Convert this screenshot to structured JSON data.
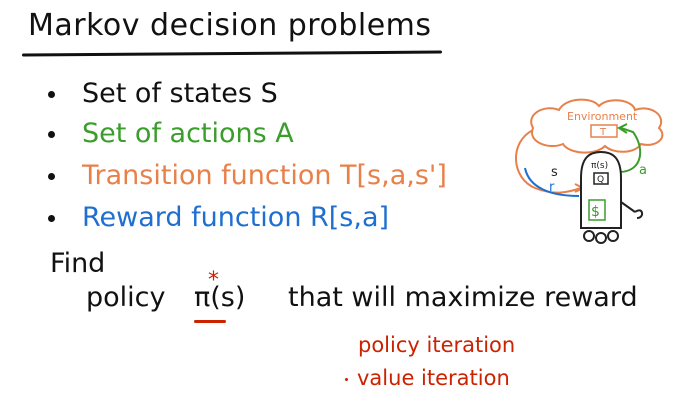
{
  "slide": {
    "title": "Markov decision problems",
    "bullets": [
      {
        "text": "Set of states S",
        "color": "#111111"
      },
      {
        "text": "Set of actions A",
        "color": "#3a9e2a"
      },
      {
        "text": "Transition function T[s,a,s']",
        "color": "#e8804a"
      },
      {
        "text": "Reward function  R[s,a]",
        "color": "#1e6fd0"
      }
    ],
    "find_label": "Find",
    "policy_word": "policy",
    "policy_symbol": "π(s)",
    "policy_star": "*",
    "policy_rest": "that will maximize reward",
    "methods": [
      "policy iteration",
      "value iteration"
    ]
  },
  "diagram": {
    "environment_label": "Environment",
    "t_label": "T",
    "s_label": "s",
    "r_label": "r",
    "a_label": "a",
    "robot_pi_label": "π(s)",
    "robot_q_label": "Q",
    "robot_dollar_label": "$",
    "colors": {
      "environment": "#e8804a",
      "action": "#3a9e2a",
      "reward": "#1e6fd0",
      "robot": "#222222",
      "dollar": "#3a9e2a"
    }
  }
}
